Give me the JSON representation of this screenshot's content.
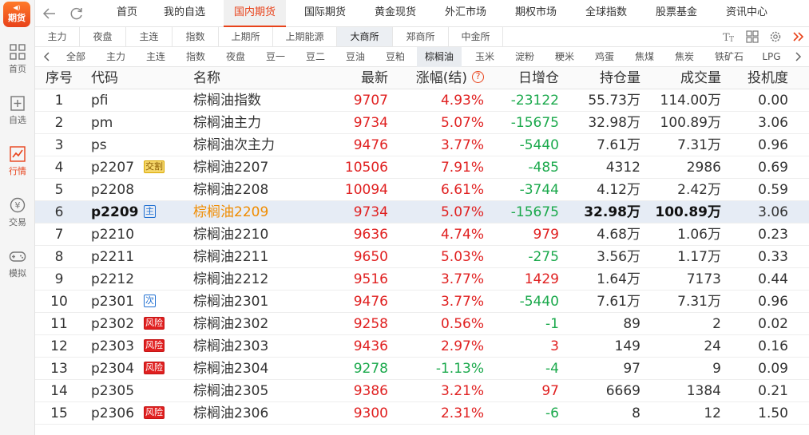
{
  "sidebar": {
    "logo": {
      "top": "◀)",
      "text": "期货"
    },
    "items": [
      {
        "label": "首页",
        "icon": "grid-icon",
        "active": false
      },
      {
        "label": "自选",
        "icon": "add-list-icon",
        "active": false
      },
      {
        "label": "行情",
        "icon": "chart-icon",
        "active": true
      },
      {
        "label": "交易",
        "icon": "yuan-icon",
        "active": false
      },
      {
        "label": "模拟",
        "icon": "gamepad-icon",
        "active": false
      }
    ]
  },
  "topnav": {
    "items": [
      "首页",
      "我的自选",
      "国内期货",
      "国际期货",
      "黄金现货",
      "外汇市场",
      "期权市场",
      "全球指数",
      "股票基金",
      "资讯中心"
    ],
    "active_index": 2
  },
  "subtabs": {
    "items": [
      "主力",
      "夜盘",
      "主连",
      "指数",
      "上期所",
      "上期能源",
      "大商所",
      "郑商所",
      "中金所"
    ],
    "active_index": 6
  },
  "categories": {
    "items": [
      "全部",
      "主力",
      "主连",
      "指数",
      "夜盘",
      "豆一",
      "豆二",
      "豆油",
      "豆粕",
      "棕榈油",
      "玉米",
      "淀粉",
      "粳米",
      "鸡蛋",
      "焦煤",
      "焦炭",
      "铁矿石",
      "LPG"
    ],
    "active_index": 9
  },
  "table": {
    "headers": {
      "idx": "序号",
      "code": "代码",
      "name": "名称",
      "last": "最新",
      "chg": "涨幅(结)",
      "help": "?",
      "oi_delta": "日增仓",
      "oi": "持仓量",
      "vol": "成交量",
      "spec": "投机度"
    },
    "rows": [
      {
        "idx": "1",
        "code": "pfi",
        "tag": "",
        "tagtype": "",
        "name": "棕榈油指数",
        "last": "9707",
        "chg": "4.93%",
        "oi_delta": "-23122",
        "oi": "55.73万",
        "vol": "114.00万",
        "spec": "0.00",
        "dir": "up",
        "delta_dir": "down"
      },
      {
        "idx": "2",
        "code": "pm",
        "tag": "",
        "tagtype": "",
        "name": "棕榈油主力",
        "last": "9734",
        "chg": "5.07%",
        "oi_delta": "-15675",
        "oi": "32.98万",
        "vol": "100.89万",
        "spec": "3.06",
        "dir": "up",
        "delta_dir": "down"
      },
      {
        "idx": "3",
        "code": "ps",
        "tag": "",
        "tagtype": "",
        "name": "棕榈油次主力",
        "last": "9476",
        "chg": "3.77%",
        "oi_delta": "-5440",
        "oi": "7.61万",
        "vol": "7.31万",
        "spec": "0.96",
        "dir": "up",
        "delta_dir": "down"
      },
      {
        "idx": "4",
        "code": "p2207",
        "tag": "交割",
        "tagtype": "jiaoge",
        "name": "棕榈油2207",
        "last": "10506",
        "chg": "7.91%",
        "oi_delta": "-485",
        "oi": "4312",
        "vol": "2986",
        "spec": "0.69",
        "dir": "up",
        "delta_dir": "down"
      },
      {
        "idx": "5",
        "code": "p2208",
        "tag": "",
        "tagtype": "",
        "name": "棕榈油2208",
        "last": "10094",
        "chg": "6.61%",
        "oi_delta": "-3744",
        "oi": "4.12万",
        "vol": "2.42万",
        "spec": "0.59",
        "dir": "up",
        "delta_dir": "down"
      },
      {
        "idx": "6",
        "code": "p2209",
        "tag": "主",
        "tagtype": "zhu",
        "name": "棕榈油2209",
        "last": "9734",
        "chg": "5.07%",
        "oi_delta": "-15675",
        "oi": "32.98万",
        "vol": "100.89万",
        "spec": "3.06",
        "dir": "up",
        "delta_dir": "down",
        "selected": true
      },
      {
        "idx": "7",
        "code": "p2210",
        "tag": "",
        "tagtype": "",
        "name": "棕榈油2210",
        "last": "9636",
        "chg": "4.74%",
        "oi_delta": "979",
        "oi": "4.68万",
        "vol": "1.06万",
        "spec": "0.23",
        "dir": "up",
        "delta_dir": "up"
      },
      {
        "idx": "8",
        "code": "p2211",
        "tag": "",
        "tagtype": "",
        "name": "棕榈油2211",
        "last": "9650",
        "chg": "5.03%",
        "oi_delta": "-275",
        "oi": "3.56万",
        "vol": "1.17万",
        "spec": "0.33",
        "dir": "up",
        "delta_dir": "down"
      },
      {
        "idx": "9",
        "code": "p2212",
        "tag": "",
        "tagtype": "",
        "name": "棕榈油2212",
        "last": "9516",
        "chg": "3.77%",
        "oi_delta": "1429",
        "oi": "1.64万",
        "vol": "7173",
        "spec": "0.44",
        "dir": "up",
        "delta_dir": "up"
      },
      {
        "idx": "10",
        "code": "p2301",
        "tag": "次",
        "tagtype": "ci",
        "name": "棕榈油2301",
        "last": "9476",
        "chg": "3.77%",
        "oi_delta": "-5440",
        "oi": "7.61万",
        "vol": "7.31万",
        "spec": "0.96",
        "dir": "up",
        "delta_dir": "down"
      },
      {
        "idx": "11",
        "code": "p2302",
        "tag": "风险",
        "tagtype": "risk",
        "name": "棕榈油2302",
        "last": "9258",
        "chg": "0.56%",
        "oi_delta": "-1",
        "oi": "89",
        "vol": "2",
        "spec": "0.02",
        "dir": "up",
        "delta_dir": "down"
      },
      {
        "idx": "12",
        "code": "p2303",
        "tag": "风险",
        "tagtype": "risk",
        "name": "棕榈油2303",
        "last": "9436",
        "chg": "2.97%",
        "oi_delta": "3",
        "oi": "149",
        "vol": "24",
        "spec": "0.16",
        "dir": "up",
        "delta_dir": "up"
      },
      {
        "idx": "13",
        "code": "p2304",
        "tag": "风险",
        "tagtype": "risk",
        "name": "棕榈油2304",
        "last": "9278",
        "chg": "-1.13%",
        "oi_delta": "-4",
        "oi": "97",
        "vol": "9",
        "spec": "0.09",
        "dir": "down",
        "delta_dir": "down"
      },
      {
        "idx": "14",
        "code": "p2305",
        "tag": "",
        "tagtype": "",
        "name": "棕榈油2305",
        "last": "9386",
        "chg": "3.21%",
        "oi_delta": "97",
        "oi": "6669",
        "vol": "1384",
        "spec": "0.21",
        "dir": "up",
        "delta_dir": "up"
      },
      {
        "idx": "15",
        "code": "p2306",
        "tag": "风险",
        "tagtype": "risk",
        "name": "棕榈油2306",
        "last": "9300",
        "chg": "2.31%",
        "oi_delta": "-6",
        "oi": "8",
        "vol": "12",
        "spec": "1.50",
        "dir": "up",
        "delta_dir": "down"
      }
    ]
  },
  "colors": {
    "accent": "#e8421a",
    "up": "#e02020",
    "down": "#1ba94c",
    "selected_row": "#e6ecf5",
    "selected_name": "#f08c00"
  }
}
